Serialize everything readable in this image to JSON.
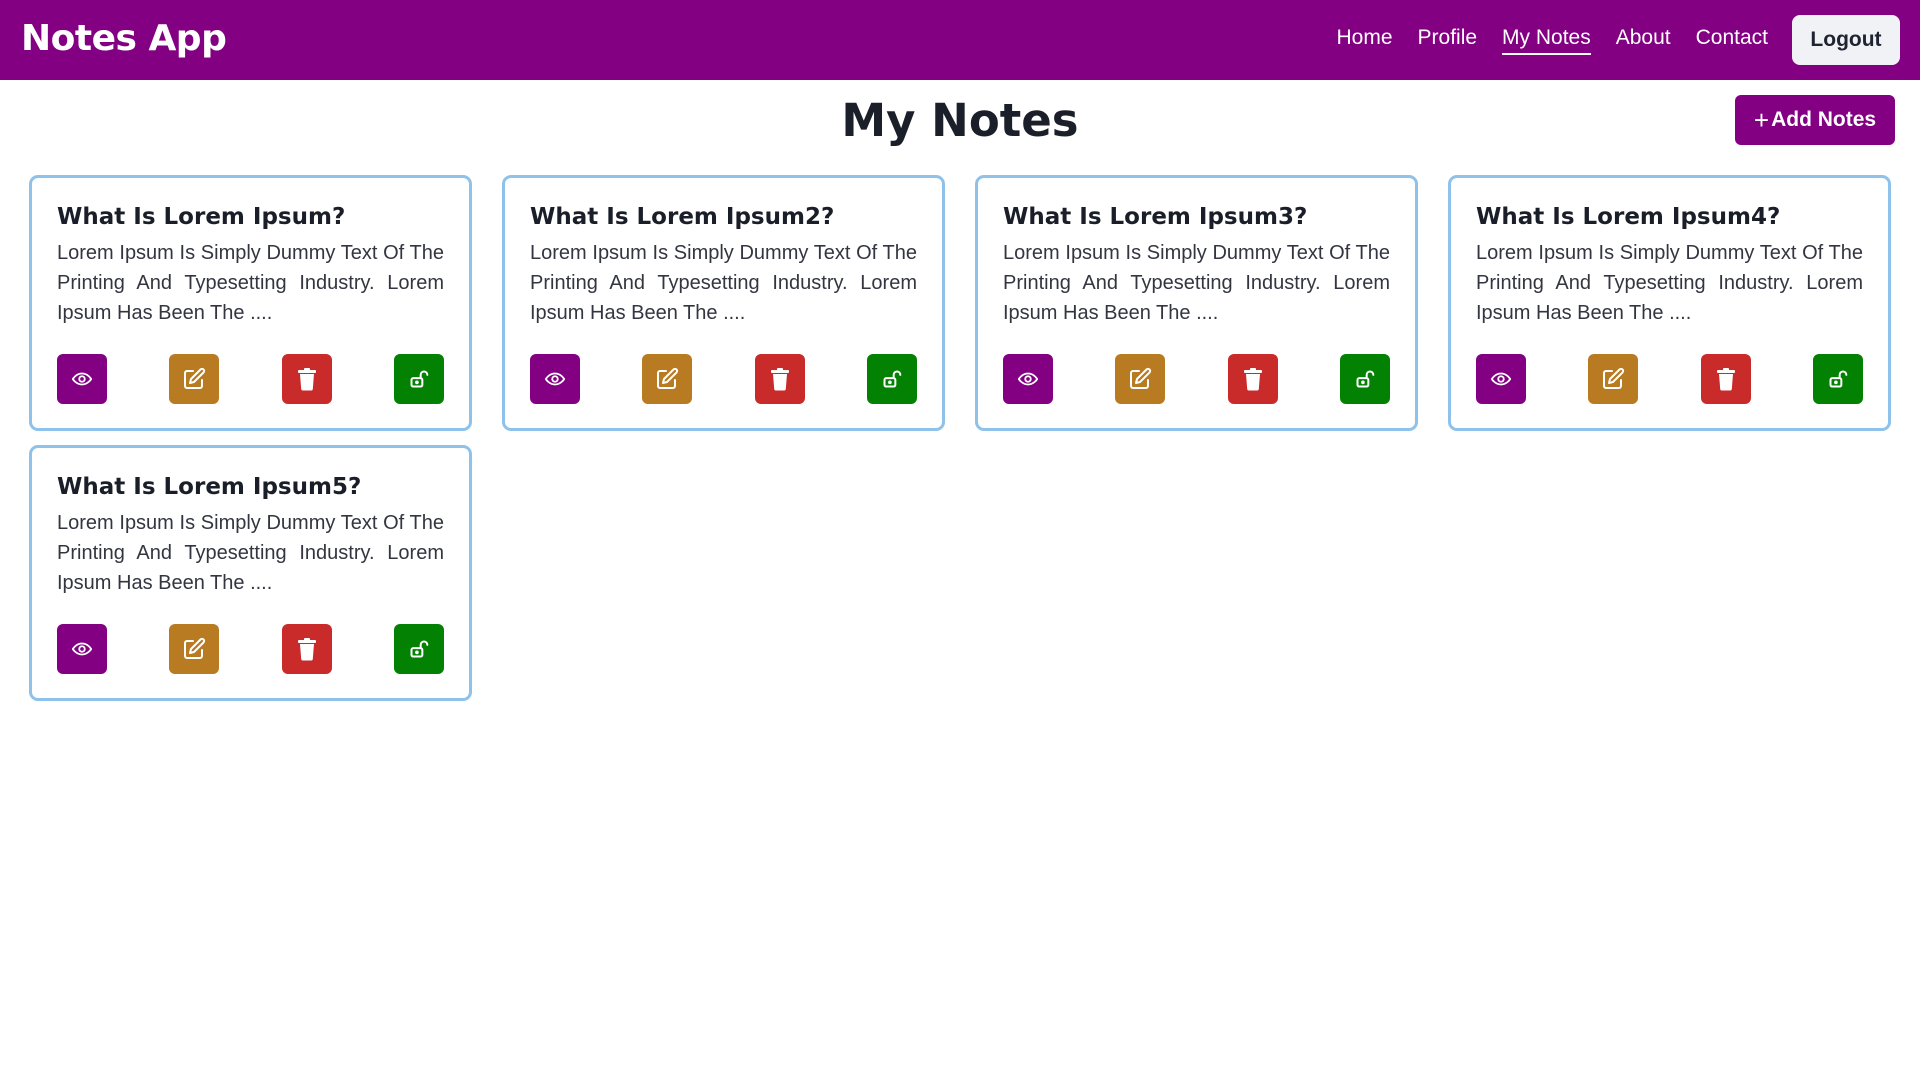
{
  "app": {
    "title": "Notes App"
  },
  "nav": {
    "links": [
      {
        "label": "Home",
        "active": false
      },
      {
        "label": "Profile",
        "active": false
      },
      {
        "label": "My Notes",
        "active": true
      },
      {
        "label": "About",
        "active": false
      },
      {
        "label": "Contact",
        "active": false
      }
    ],
    "logout_label": "Logout"
  },
  "page": {
    "title": "My Notes",
    "add_plus": "+",
    "add_label": "Add Notes"
  },
  "notes": [
    {
      "title": "What Is Lorem Ipsum?",
      "body": "Lorem Ipsum Is Simply Dummy Text Of The Printing And Typesetting Industry. Lorem Ipsum Has Been The ...."
    },
    {
      "title": "What Is Lorem Ipsum2?",
      "body": "Lorem Ipsum Is Simply Dummy Text Of The Printing And Typesetting Industry. Lorem Ipsum Has Been The ...."
    },
    {
      "title": "What Is Lorem Ipsum3?",
      "body": "Lorem Ipsum Is Simply Dummy Text Of The Printing And Typesetting Industry. Lorem Ipsum Has Been The ...."
    },
    {
      "title": "What Is Lorem Ipsum4?",
      "body": "Lorem Ipsum Is Simply Dummy Text Of The Printing And Typesetting Industry. Lorem Ipsum Has Been The ...."
    },
    {
      "title": "What Is Lorem Ipsum5?",
      "body": "Lorem Ipsum Is Simply Dummy Text Of The Printing And Typesetting Industry. Lorem Ipsum Has Been The ...."
    }
  ],
  "note_actions": [
    {
      "name": "view",
      "icon": "eye-icon",
      "color": "#830083"
    },
    {
      "name": "edit",
      "icon": "edit-icon",
      "color": "#b87b21"
    },
    {
      "name": "delete",
      "icon": "trash-icon",
      "color": "#c92a2a"
    },
    {
      "name": "lock",
      "icon": "unlock-icon",
      "color": "#038103"
    }
  ],
  "colors": {
    "primary": "#830083",
    "card_border": "#8ec2ea",
    "logout_bg": "#f1f2f6"
  }
}
